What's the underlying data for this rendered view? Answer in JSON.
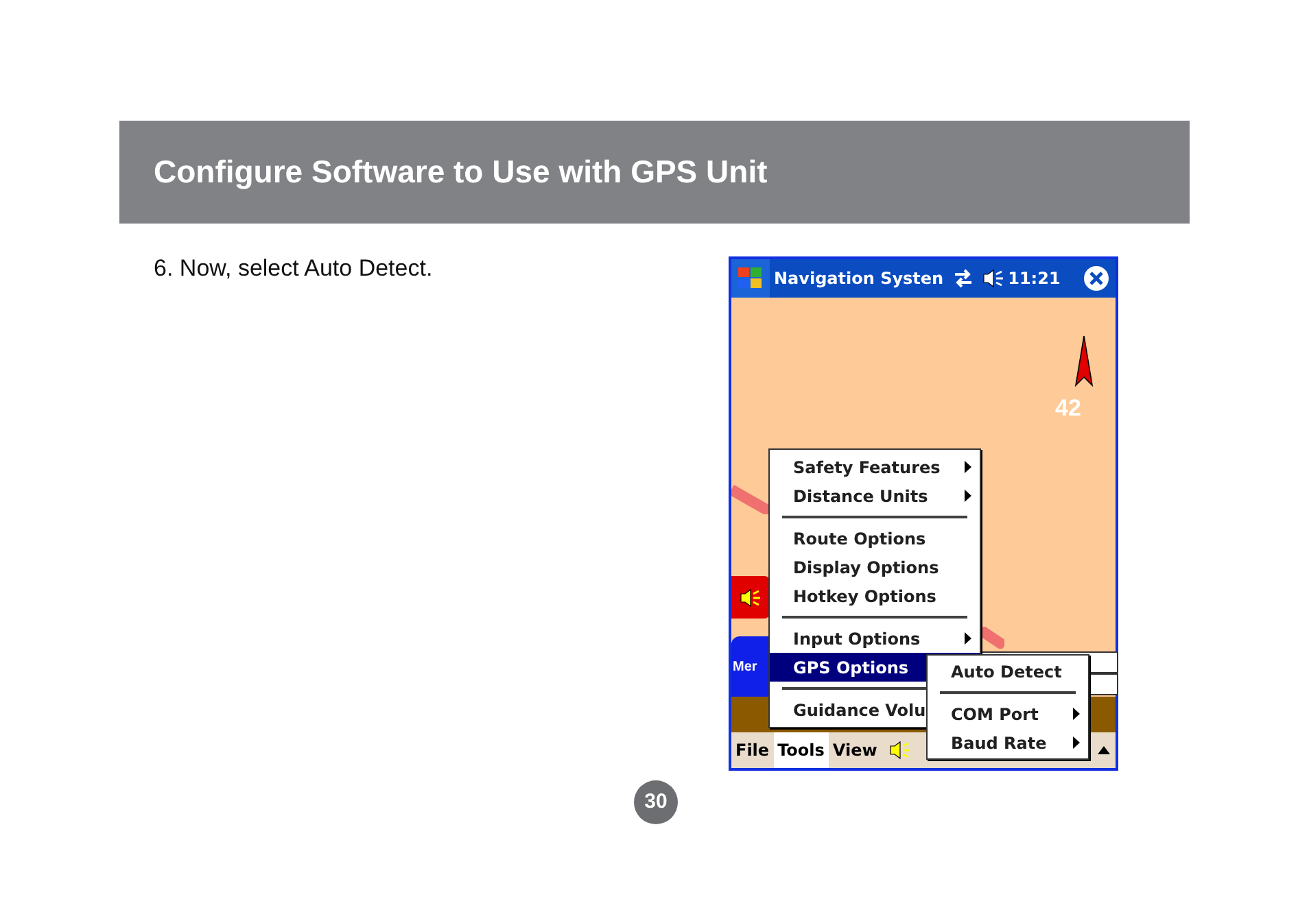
{
  "header": {
    "title": "Configure Software to Use with GPS Unit"
  },
  "step": {
    "number": "6.",
    "text": "Now, select Auto Detect."
  },
  "device": {
    "title_bar": {
      "title": "Navigation Systen",
      "time": "11:21"
    },
    "map": {
      "speed": "42",
      "menu_button": "Mer"
    },
    "menu": [
      {
        "kind": "item",
        "label": "Safety Features",
        "submenu": true,
        "selected": false
      },
      {
        "kind": "item",
        "label": "Distance Units",
        "submenu": true,
        "selected": false
      },
      {
        "kind": "separator"
      },
      {
        "kind": "item",
        "label": "Route Options",
        "submenu": false,
        "selected": false
      },
      {
        "kind": "item",
        "label": "Display Options",
        "submenu": false,
        "selected": false
      },
      {
        "kind": "item",
        "label": "Hotkey Options",
        "submenu": false,
        "selected": false
      },
      {
        "kind": "separator"
      },
      {
        "kind": "item",
        "label": "Input Options",
        "submenu": true,
        "selected": false
      },
      {
        "kind": "item",
        "label": "GPS Options",
        "submenu": true,
        "selected": true
      },
      {
        "kind": "separator"
      },
      {
        "kind": "item",
        "label": "Guidance Volu",
        "selected": false
      }
    ],
    "submenu": [
      {
        "kind": "item",
        "label": "Auto Detect",
        "submenu": false
      },
      {
        "kind": "separator"
      },
      {
        "kind": "item",
        "label": "COM Port",
        "submenu": true
      },
      {
        "kind": "item",
        "label": "Baud Rate",
        "submenu": true
      }
    ],
    "menu_bar": [
      {
        "label": "File",
        "selected": false
      },
      {
        "label": "Tools",
        "selected": true
      },
      {
        "label": "View",
        "selected": false
      }
    ]
  },
  "page_number": "30"
}
